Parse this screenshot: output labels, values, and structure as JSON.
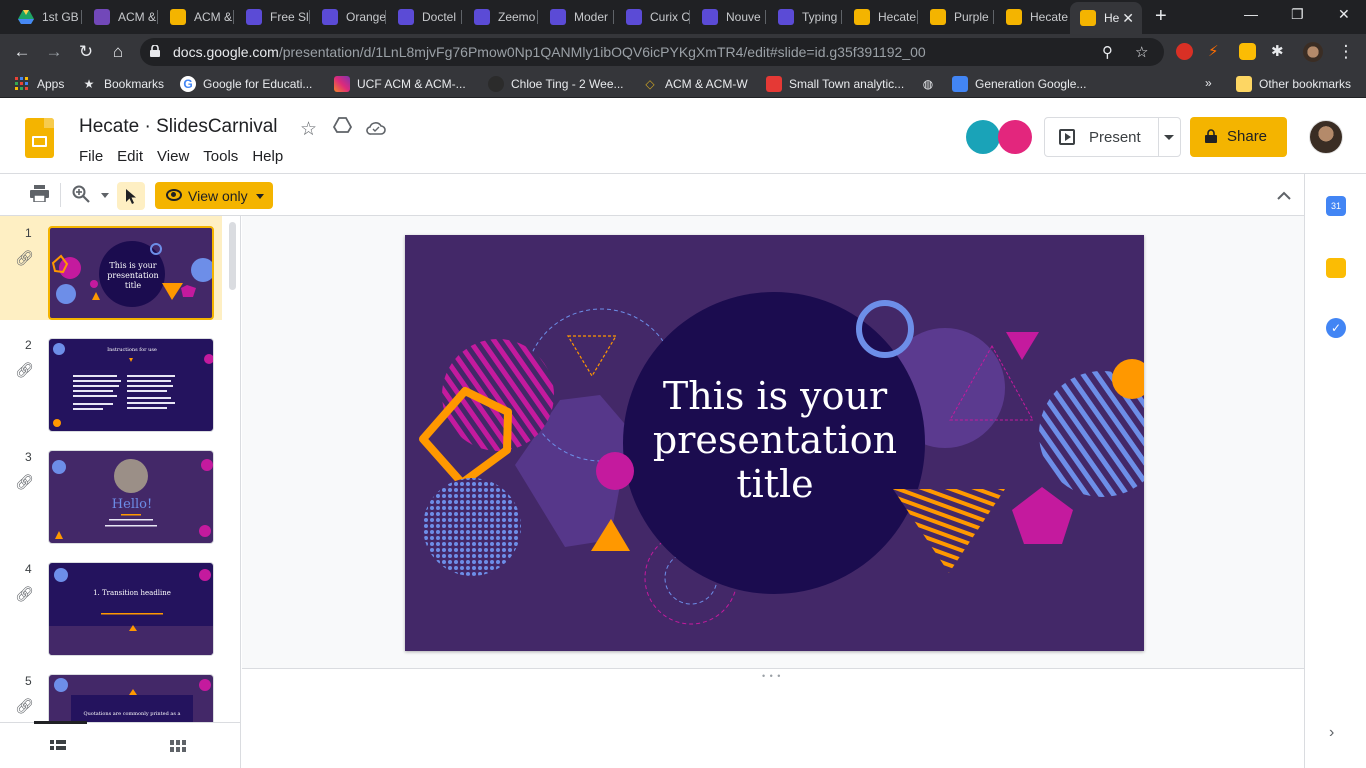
{
  "browser": {
    "tabs": [
      {
        "label": "1st GB",
        "color": "#1fa463"
      },
      {
        "label": "ACM &",
        "color": "#7248b9"
      },
      {
        "label": "ACM &",
        "color": "#f4b400"
      },
      {
        "label": "Free Sl",
        "color": "#5b4bd6"
      },
      {
        "label": "Orange",
        "color": "#5b4bd6"
      },
      {
        "label": "Doctel",
        "color": "#5b4bd6"
      },
      {
        "label": "Zeemo",
        "color": "#5b4bd6"
      },
      {
        "label": "Moder",
        "color": "#5b4bd6"
      },
      {
        "label": "Curix C",
        "color": "#5b4bd6"
      },
      {
        "label": "Nouve",
        "color": "#5b4bd6"
      },
      {
        "label": "Typing",
        "color": "#5b4bd6"
      },
      {
        "label": "Hecate",
        "color": "#f4b400"
      },
      {
        "label": "Purple",
        "color": "#f4b400"
      },
      {
        "label": "Hecate",
        "color": "#f4b400"
      },
      {
        "label": "He",
        "color": "#f4b400"
      }
    ],
    "url_host": "docs.google.com",
    "url_path": "/presentation/d/1LnL8mjvFg76Pmow0Np1QANMly1ibOQV6icPYKgXmTR4/edit#slide=id.g35f391192_00",
    "bookmarks": [
      {
        "label": "Apps",
        "icon": "apps-grid-icon"
      },
      {
        "label": "Bookmarks",
        "icon": "star-icon"
      },
      {
        "label": "Google for Educati...",
        "icon": "google-icon"
      },
      {
        "label": "UCF ACM & ACM-...",
        "icon": "instagram-icon"
      },
      {
        "label": "Chloe Ting - 2 Wee...",
        "icon": "figure-icon"
      },
      {
        "label": "ACM & ACM-W",
        "icon": "diamond-icon"
      },
      {
        "label": "Small Town analytic...",
        "icon": "store-icon"
      },
      {
        "label": "",
        "icon": "globe-icon"
      },
      {
        "label": "Generation Google...",
        "icon": "doc-icon"
      }
    ],
    "overflow_label": "»",
    "other_bookmarks": "Other bookmarks"
  },
  "app": {
    "doc_title": "Hecate · SlidesCarnival",
    "menu": [
      "File",
      "Edit",
      "View",
      "Tools",
      "Help"
    ],
    "present_label": "Present",
    "share_label": "Share",
    "view_only_label": "View only"
  },
  "filmstrip": {
    "slides": [
      {
        "number": "1",
        "text": "This is your presentation title"
      },
      {
        "number": "2",
        "text": "Instructions for use"
      },
      {
        "number": "3",
        "text": "Hello!"
      },
      {
        "number": "4",
        "text": "1. Transition headline"
      },
      {
        "number": "5",
        "text": "Quotations are commonly printed as a"
      }
    ]
  },
  "slide": {
    "title": "This is your presentation title"
  },
  "colors": {
    "slide_bg": "#432868",
    "circle_dark": "#1b0c4f",
    "magenta": "#c41a9e",
    "orange": "#ff9800",
    "blue": "#6d8ee8",
    "accent_yellow": "#f4b400"
  }
}
